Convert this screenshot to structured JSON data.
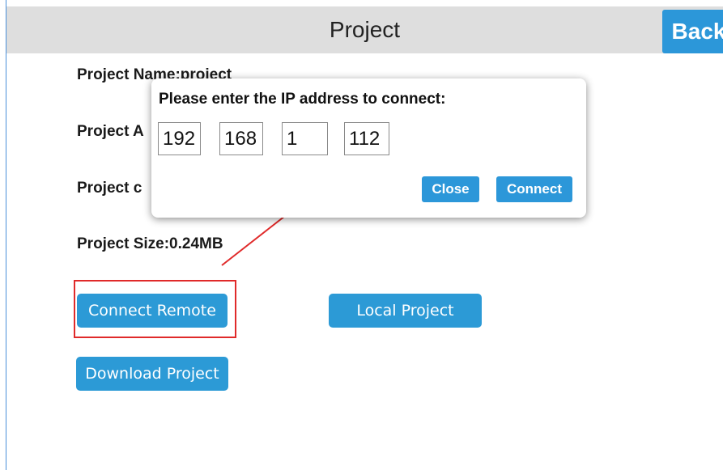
{
  "header": {
    "title": "Project",
    "back_label": "Back"
  },
  "info": {
    "name": "Project Name:project",
    "address_partial": "Project A",
    "config_partial": "Project c",
    "size": "Project Size:0.24MB"
  },
  "buttons": {
    "connect_remote": "Connect Remote",
    "local_project": "Local Project",
    "download_project": "Download Project"
  },
  "dialog": {
    "title": "Please enter the IP address to connect:",
    "ip": [
      "192",
      "168",
      "1",
      "112"
    ],
    "close_label": "Close",
    "connect_label": "Connect"
  },
  "colors": {
    "accent": "#2c97d9",
    "header_bg": "#dedede",
    "annotation": "#e02a2a"
  }
}
